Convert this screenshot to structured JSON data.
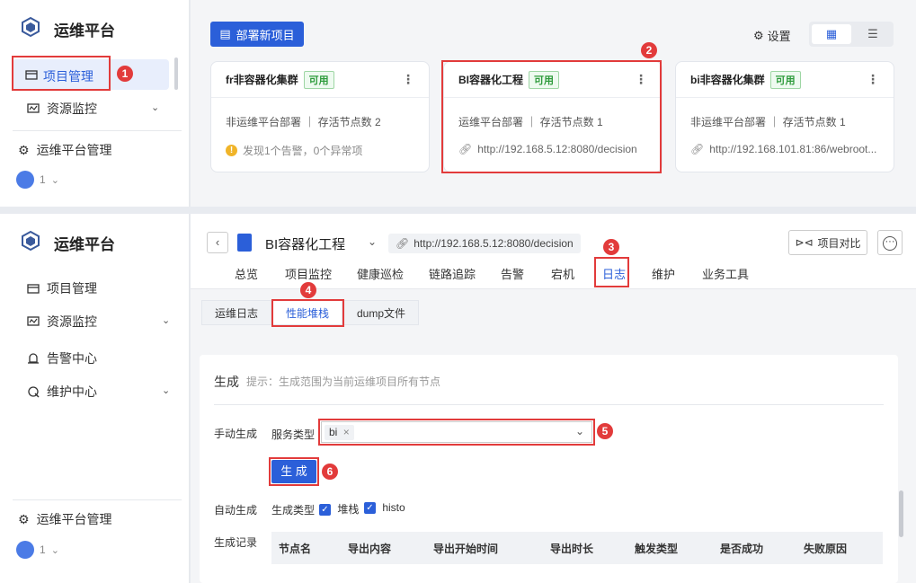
{
  "app": {
    "name": "运维平台"
  },
  "top_sidebar": {
    "items": [
      {
        "label": "项目管理",
        "icon": "folder-icon"
      },
      {
        "label": "资源监控",
        "icon": "monitor-icon"
      }
    ],
    "platform_manage": "运维平台管理",
    "user_count": "1"
  },
  "toolbar": {
    "deploy_button": "部署新项目",
    "settings": "设置"
  },
  "cards": [
    {
      "name": "fr非容器化集群",
      "status": "可用",
      "meta": "非运维平台部署 ｜ 存活节点数 2",
      "extra": "发现1个告警，0个异常项",
      "extra_icon": "warning-icon"
    },
    {
      "name": "BI容器化工程",
      "status": "可用",
      "meta": "运维平台部署 ｜ 存活节点数 1",
      "extra": "http://192.168.5.12:8080/decision",
      "extra_icon": "link-icon"
    },
    {
      "name": "bi非容器化集群",
      "status": "可用",
      "meta": "非运维平台部署 ｜ 存活节点数 1",
      "extra": "http://192.168.101.81:86/webroot...",
      "extra_icon": "link-icon"
    }
  ],
  "bottom_sidebar": {
    "items": [
      {
        "label": "项目管理",
        "icon": "folder-icon"
      },
      {
        "label": "资源监控",
        "icon": "monitor-icon"
      },
      {
        "label": "告警中心",
        "icon": "alarm-icon"
      },
      {
        "label": "维护中心",
        "icon": "maintenance-icon"
      }
    ],
    "platform_manage": "运维平台管理",
    "user_count": "1"
  },
  "project": {
    "title": "BI容器化工程",
    "url": "http://192.168.5.12:8080/decision",
    "compare_button": "项目对比"
  },
  "tabs": [
    "总览",
    "项目监控",
    "健康巡检",
    "链路追踪",
    "告警",
    "宕机",
    "日志",
    "维护",
    "业务工具"
  ],
  "active_tab": "日志",
  "subtabs": [
    "运维日志",
    "性能堆栈",
    "dump文件"
  ],
  "active_subtab": "性能堆栈",
  "generate": {
    "title": "生成",
    "hint": "提示：生成范围为当前运维项目所有节点",
    "manual_label": "手动生成",
    "service_type_label": "服务类型",
    "service_tag": "bi",
    "generate_button": "生 成",
    "auto_label": "自动生成",
    "gen_type_label": "生成类型",
    "opt1": "堆栈",
    "opt2": "histo",
    "records_label": "生成记录"
  },
  "table": {
    "headers": [
      "节点名",
      "导出内容",
      "导出开始时间",
      "导出时长",
      "触发类型",
      "是否成功",
      "失败原因"
    ]
  },
  "markers": [
    "1",
    "2",
    "3",
    "4",
    "5",
    "6"
  ],
  "colors": {
    "primary": "#2b5fd9",
    "marker": "#e23b3b",
    "ok": "#2e9b3c",
    "warn": "#f0b429"
  }
}
